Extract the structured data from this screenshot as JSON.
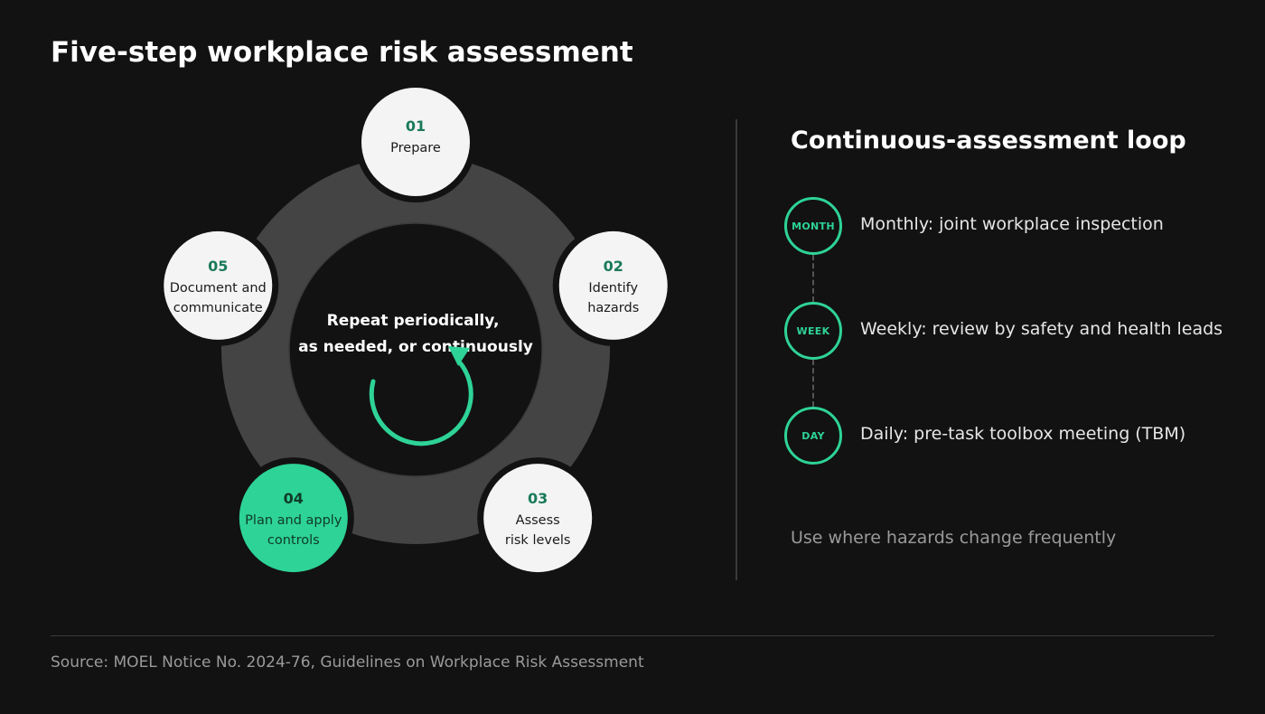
{
  "title": "Five-step workplace risk assessment",
  "cycle": {
    "center_lines": [
      "Repeat periodically,",
      "as needed, or continuously"
    ],
    "steps": [
      {
        "number": "01",
        "lines": [
          "Prepare"
        ],
        "highlight": false
      },
      {
        "number": "02",
        "lines": [
          "Identify",
          "hazards"
        ],
        "highlight": false
      },
      {
        "number": "03",
        "lines": [
          "Assess",
          "risk levels"
        ],
        "highlight": false
      },
      {
        "number": "04",
        "lines": [
          "Plan and apply",
          "controls"
        ],
        "highlight": true
      },
      {
        "number": "05",
        "lines": [
          "Document and",
          "communicate"
        ],
        "highlight": false
      }
    ]
  },
  "loop": {
    "title": "Continuous-assessment loop",
    "items": [
      {
        "badge": "MONTH",
        "text": "Monthly: joint workplace inspection"
      },
      {
        "badge": "WEEK",
        "text": "Weekly: review by safety and health leads"
      },
      {
        "badge": "DAY",
        "text": "Daily: pre-task toolbox meeting (TBM)"
      }
    ],
    "note": "Use where hazards change frequently"
  },
  "source": "Source: MOEL Notice No. 2024-76, Guidelines on Workplace Risk Assessment",
  "colors": {
    "accent": "#2ed397",
    "number": "#1a7a5a",
    "node_fill": "#f4f4f4",
    "ring": "#444444",
    "inner": "#121212",
    "background": "#121212"
  }
}
